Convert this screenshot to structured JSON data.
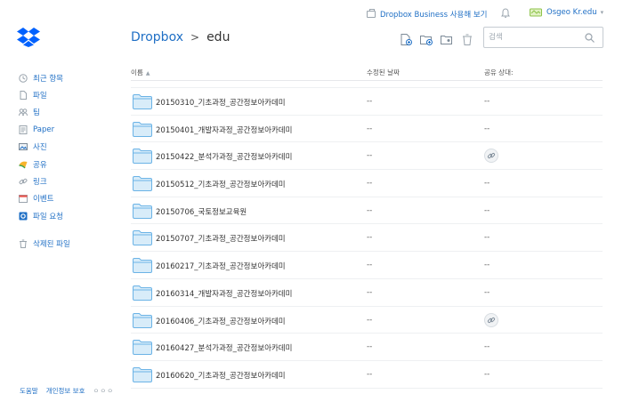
{
  "topbar": {
    "business_label": "Dropbox Business 사용해 보기",
    "user_name": "Osgeo Kr.edu"
  },
  "breadcrumb": {
    "root": "Dropbox",
    "separator": ">",
    "current": "edu"
  },
  "search": {
    "placeholder": "검색"
  },
  "sidebar": {
    "items": [
      {
        "label": "최근 항목",
        "icon": "clock-icon"
      },
      {
        "label": "파일",
        "icon": "file-icon"
      },
      {
        "label": "팀",
        "icon": "team-icon"
      },
      {
        "label": "Paper",
        "icon": "paper-icon"
      },
      {
        "label": "사진",
        "icon": "photo-icon"
      },
      {
        "label": "공유",
        "icon": "share-icon"
      },
      {
        "label": "링크",
        "icon": "link-icon"
      },
      {
        "label": "이벤트",
        "icon": "calendar-icon"
      },
      {
        "label": "파일 요청",
        "icon": "file-request-icon"
      }
    ],
    "deleted_label": "삭제된 파일"
  },
  "footer": {
    "help": "도움말",
    "privacy": "개인정보 보호",
    "more": "ㅇㅇㅇ"
  },
  "table": {
    "columns": {
      "name": "이름",
      "modified": "수정된 날짜",
      "sharing": "공유 상대:"
    },
    "sort_arrow": "▲",
    "rows": [
      {
        "name": "20150310_기초과정_공간정보아카데미",
        "modified": "--",
        "shared": "--"
      },
      {
        "name": "20150401_개발자과정_공간정보아카데미",
        "modified": "--",
        "shared": "--"
      },
      {
        "name": "20150422_분석가과정_공간정보아카데미",
        "modified": "--",
        "shared": "link"
      },
      {
        "name": "20150512_기초과정_공간정보아카데미",
        "modified": "--",
        "shared": "--"
      },
      {
        "name": "20150706_국토정보교육원",
        "modified": "--",
        "shared": "--"
      },
      {
        "name": "20150707_기초과정_공간정보아카데미",
        "modified": "--",
        "shared": "--"
      },
      {
        "name": "20160217_기초과정_공간정보아카데미",
        "modified": "--",
        "shared": "--"
      },
      {
        "name": "20160314_개발자과정_공간정보아카데미",
        "modified": "--",
        "shared": "--"
      },
      {
        "name": "20160406_기초과정_공간정보아카데미",
        "modified": "--",
        "shared": "link"
      },
      {
        "name": "20160427_분석가과정_공간정보아카데미",
        "modified": "--",
        "shared": "--"
      },
      {
        "name": "20160620_기초과정_공간정보아카데미",
        "modified": "--",
        "shared": "--"
      }
    ]
  },
  "colors": {
    "accent": "#1f6fc5",
    "folder_fill": "#d8ecf9",
    "folder_stroke": "#6bb3e6"
  }
}
